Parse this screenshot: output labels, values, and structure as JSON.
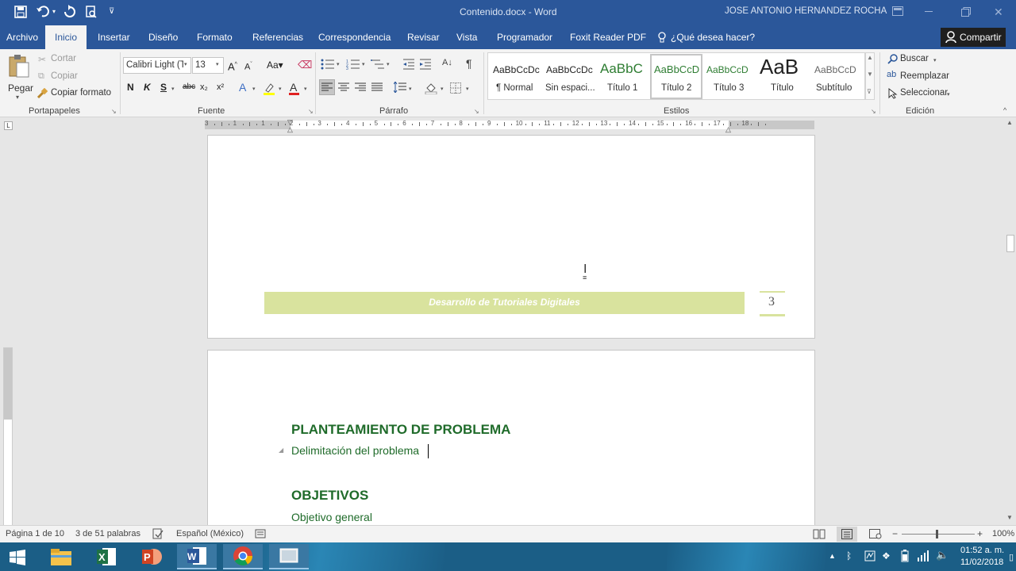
{
  "titlebar": {
    "doc_title": "Contenido.docx - Word",
    "user": "JOSE ANTONIO HERNANDEZ ROCHA"
  },
  "tabs": [
    {
      "label": "Archivo"
    },
    {
      "label": "Inicio"
    },
    {
      "label": "Insertar"
    },
    {
      "label": "Diseño"
    },
    {
      "label": "Formato"
    },
    {
      "label": "Referencias"
    },
    {
      "label": "Correspondencia"
    },
    {
      "label": "Revisar"
    },
    {
      "label": "Vista"
    },
    {
      "label": "Programador"
    },
    {
      "label": "Foxit Reader PDF"
    }
  ],
  "tell_me": "¿Qué desea hacer?",
  "share": "Compartir",
  "clipboard": {
    "paste": "Pegar",
    "cut": "Cortar",
    "copy": "Copiar",
    "format_painter": "Copiar formato",
    "group": "Portapapeles"
  },
  "font": {
    "name": "Calibri Light (T",
    "size": "13",
    "bold": "N",
    "italic": "K",
    "underline": "S",
    "strike": "abc",
    "sub": "x₂",
    "sup": "x²",
    "group": "Fuente"
  },
  "paragraph": {
    "group": "Párrafo"
  },
  "styles": {
    "items": [
      {
        "preview": "AaBbCcDc",
        "name": "¶ Normal"
      },
      {
        "preview": "AaBbCcDc",
        "name": "Sin espaci..."
      },
      {
        "preview": "AaBbC",
        "name": "Título 1"
      },
      {
        "preview": "AaBbCcD",
        "name": "Título 2"
      },
      {
        "preview": "AaBbCcD",
        "name": "Título 3"
      },
      {
        "preview": "AaB",
        "name": "Título"
      },
      {
        "preview": "AaBbCcD",
        "name": "Subtítulo"
      }
    ],
    "group": "Estilos"
  },
  "editing": {
    "find": "Buscar",
    "replace": "Reemplazar",
    "select": "Seleccionar",
    "group": "Edición"
  },
  "ruler": {
    "marks": [
      "3",
      "1",
      "1",
      "2",
      "3",
      "4",
      "5",
      "6",
      "7",
      "8",
      "9",
      "10",
      "11",
      "12",
      "13",
      "14",
      "15",
      "16",
      "17",
      "18"
    ]
  },
  "document": {
    "footer_text": "Desarrollo de Tutoriales Digitales",
    "page_number": "3",
    "heading1": "PLANTEAMIENTO DE PROBLEMA",
    "subheading1": "Delimitación del problema",
    "heading2": "OBJETIVOS",
    "subheading2": "Objetivo general"
  },
  "status": {
    "page": "Página 1 de 10",
    "words": "3 de 51 palabras",
    "language": "Español (México)",
    "zoom": "100%"
  },
  "tray": {
    "time": "01:52 a. m.",
    "date": "11/02/2018"
  },
  "colors": {
    "word_blue": "#2b579a",
    "heading_green": "#1f6b2a",
    "footer_green": "#d9e39e",
    "taskbar": "#1b5e86"
  }
}
